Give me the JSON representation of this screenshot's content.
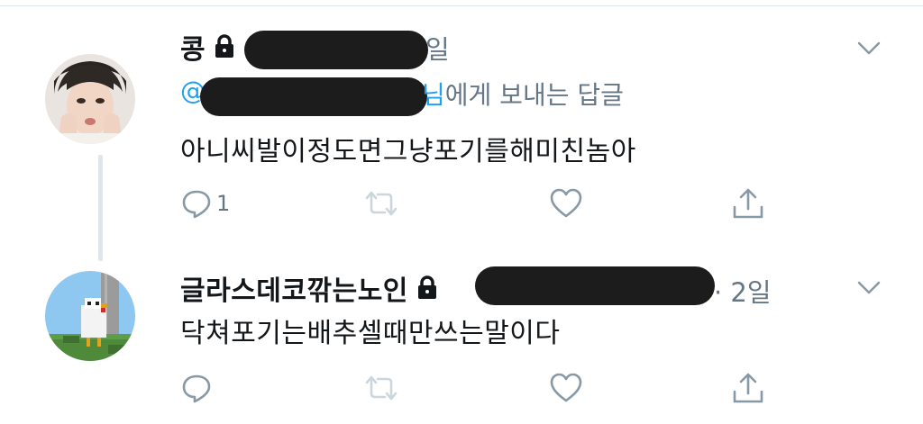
{
  "tweet1": {
    "author": "콩",
    "time_tail": "일",
    "replying_prefix": "@",
    "replying_tail": "님",
    "replying_suffix": "에게 보내는 답글",
    "text": "아니씨발이정도면그냥포기를해미친놈아",
    "reply_count": "1",
    "icons": [
      "protected-lock-icon",
      "caret-down-icon",
      "reply-icon",
      "retweet-icon",
      "like-icon",
      "share-icon"
    ]
  },
  "tweet2": {
    "author": "글라스데코깎는노인",
    "time": "· 2일",
    "text": "닥쳐포기는배추셀때만쓰는말이다",
    "icons": [
      "protected-lock-icon",
      "caret-down-icon",
      "reply-icon",
      "retweet-icon",
      "like-icon",
      "share-icon"
    ]
  },
  "colors": {
    "text": "#14171a",
    "secondary": "#657786",
    "link": "#1da1f2",
    "thread_line": "#dfe6ec",
    "redaction": "#1c1c1c"
  }
}
